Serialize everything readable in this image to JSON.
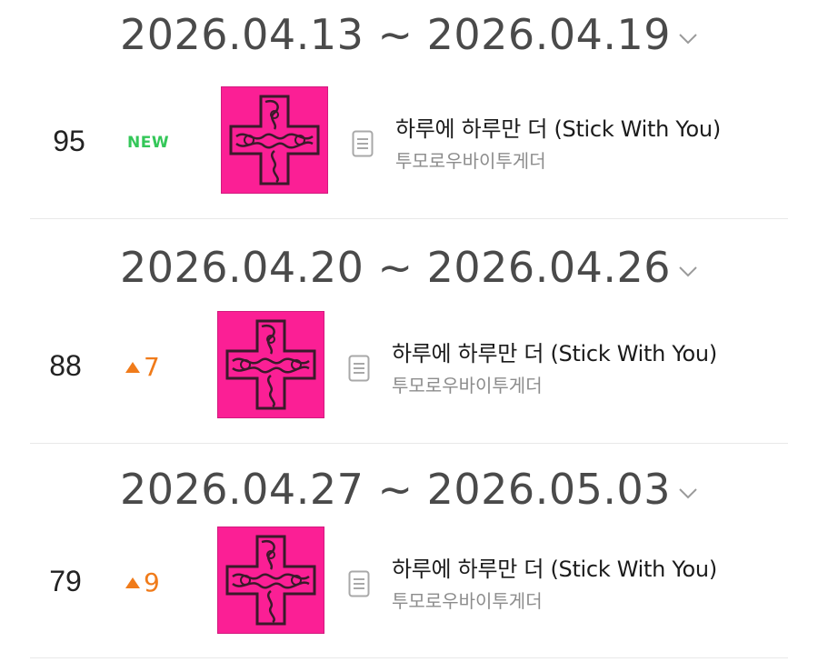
{
  "weeks": [
    {
      "date_range": "2026.04.13 ~ 2026.04.19",
      "rank": "95",
      "change_type": "new",
      "change_label": "NEW",
      "change_value": "",
      "title": "하루에 하루만 더 (Stick With You)",
      "artist": "투모로우바이투게더"
    },
    {
      "date_range": "2026.04.20 ~ 2026.04.26",
      "rank": "88",
      "change_type": "up",
      "change_label": "",
      "change_value": "7",
      "title": "하루에 하루만 더 (Stick With You)",
      "artist": "투모로우바이투게더"
    },
    {
      "date_range": "2026.04.27 ~ 2026.05.03",
      "rank": "79",
      "change_type": "up",
      "change_label": "",
      "change_value": "9",
      "title": "하루에 하루만 더 (Stick With You)",
      "artist": "투모로우바이투게더"
    }
  ],
  "colors": {
    "new": "#34c759",
    "up": "#f07b1a",
    "cover_bg": "#fb1f95",
    "cover_ink": "#3a1a2a"
  },
  "icons": [
    "chevron-down-icon",
    "lyrics-document-icon",
    "triangle-up-icon"
  ]
}
